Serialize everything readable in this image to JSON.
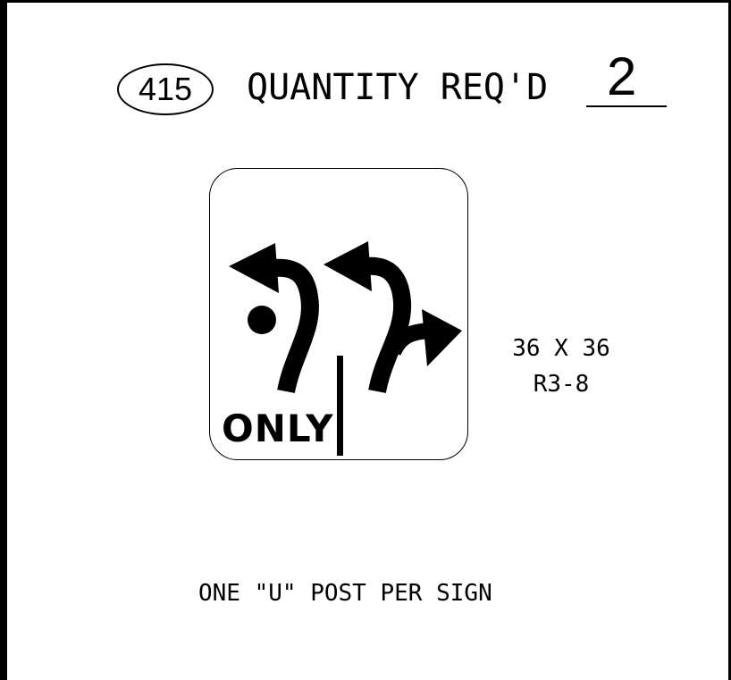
{
  "header": {
    "sign_number": "415",
    "quantity_label": "QUANTITY REQ'D",
    "quantity_value": "2"
  },
  "sign": {
    "legend": "ONLY",
    "symbol": "roundabout-left-and-through-right-lane-icon",
    "size": "36 X 36",
    "code": "R3-8"
  },
  "note": "ONE \"U\" POST PER SIGN",
  "colors": {
    "ink": "#000000",
    "background": "#ffffff"
  }
}
